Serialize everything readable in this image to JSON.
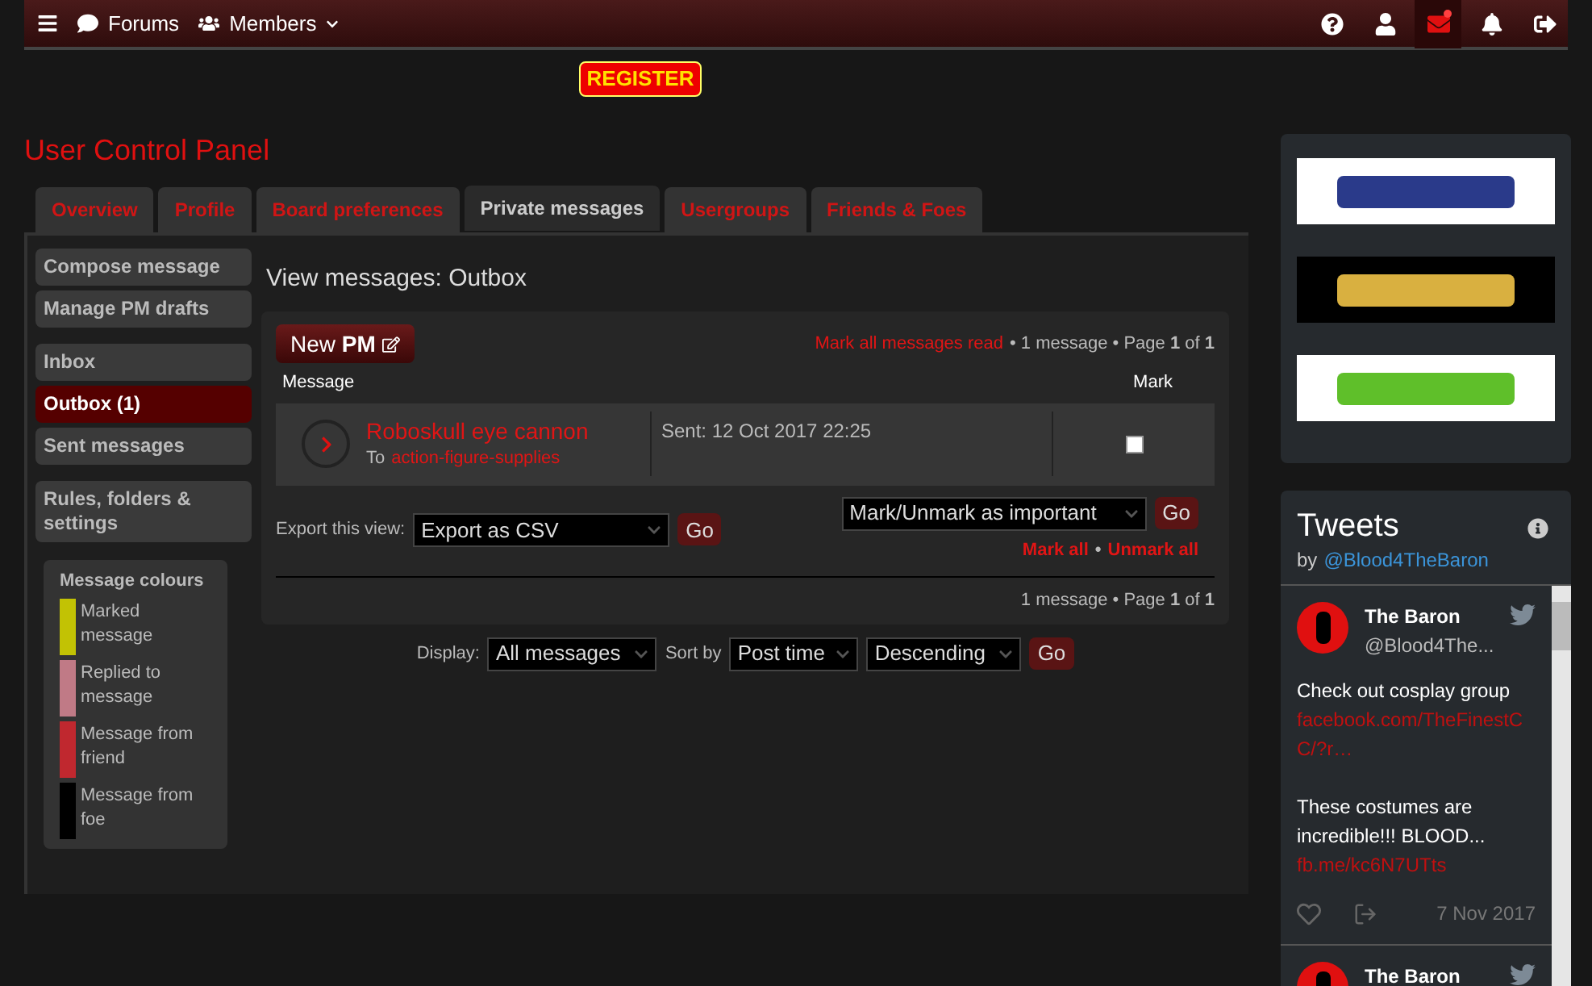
{
  "top_bar": {
    "links": [
      {
        "label": "Forums",
        "kind": "forums"
      },
      {
        "label": "Members",
        "kind": "members",
        "dropdown": true
      }
    ],
    "icons": [
      {
        "kind": "help",
        "selected": false,
        "badge": false
      },
      {
        "kind": "user",
        "selected": false,
        "badge": false
      },
      {
        "kind": "messages",
        "selected": true,
        "badge": true
      },
      {
        "kind": "bell",
        "selected": false,
        "badge": false
      },
      {
        "kind": "logout",
        "selected": false,
        "badge": false
      }
    ]
  },
  "register": "REGISTER",
  "page_title": "User Control Panel",
  "tabs": [
    {
      "label": "Overview",
      "selected": false
    },
    {
      "label": "Profile",
      "selected": false
    },
    {
      "label": "Board preferences",
      "selected": false
    },
    {
      "label": "Private messages",
      "selected": true
    },
    {
      "label": "Usergroups",
      "selected": false
    },
    {
      "label": "Friends & Foes",
      "selected": false
    }
  ],
  "side_menu": [
    [
      {
        "label": "Compose message",
        "selected": false
      },
      {
        "label": "Manage PM drafts",
        "selected": false
      }
    ],
    [
      {
        "label": "Inbox",
        "selected": false
      },
      {
        "label": "Outbox (1)",
        "selected": true
      },
      {
        "label": "Sent messages",
        "selected": false
      }
    ],
    [
      {
        "label": "Rules, folders & settings",
        "selected": false
      }
    ]
  ],
  "legend": {
    "title": "Message colours",
    "items": [
      {
        "label": "Marked message",
        "color": "#c2c204"
      },
      {
        "label": "Replied to message",
        "color": "#c07a86"
      },
      {
        "label": "Message from friend",
        "color": "#c0282f"
      },
      {
        "label": "Message from foe",
        "color": "#000000"
      }
    ]
  },
  "heading": "View messages: Outbox",
  "new_pm": "New **PM**",
  "mark_all_read": "Mark all messages read",
  "pagination_top": "• 1 message • Page **1** of **1**",
  "columns": [
    "Message",
    "Mark"
  ],
  "messages": [
    {
      "subject": "Roboskull eye cannon",
      "to_label": "To",
      "recipient": "action-figure-supplies",
      "sent": "Sent: 12 Oct 2017 22:25",
      "checked": false
    }
  ],
  "export_label": "Export this view:",
  "export_select": "Export as CSV",
  "go": "Go",
  "mark_select": "Mark/Unmark as important",
  "go_mark": "Go",
  "mark_all": "Mark all",
  "separator": "•",
  "unmark_all": "Unmark all",
  "pagination_bottom": "1 message • Page **1** of **1**",
  "display": {
    "label": "Display:",
    "value": "All messages",
    "sort_label": "Sort by",
    "sort_value": "Post time",
    "order": "Descending",
    "go": "Go"
  },
  "banners": [
    {
      "kind": "gi-joe"
    },
    {
      "kind": "star-wars"
    },
    {
      "kind": "turtles"
    }
  ],
  "tweets": {
    "title": "Tweets",
    "by": "by",
    "handle": "@Blood4TheBaron",
    "items": [
      {
        "name": "The Baron",
        "handle": "@Blood4The...",
        "parts": [
          {
            "kind": "text",
            "text": "Check out cosplay group"
          },
          {
            "kind": "link",
            "text": "facebook.com/TheFinestCC/?r…"
          },
          {
            "kind": "gap"
          },
          {
            "kind": "text",
            "text": "These costumes are incredible!!! BLOOD..."
          },
          {
            "kind": "link",
            "text": "fb.me/kc6N7UTts"
          }
        ],
        "date": "7 Nov 2017"
      },
      {
        "name": "The Baron"
      }
    ]
  }
}
